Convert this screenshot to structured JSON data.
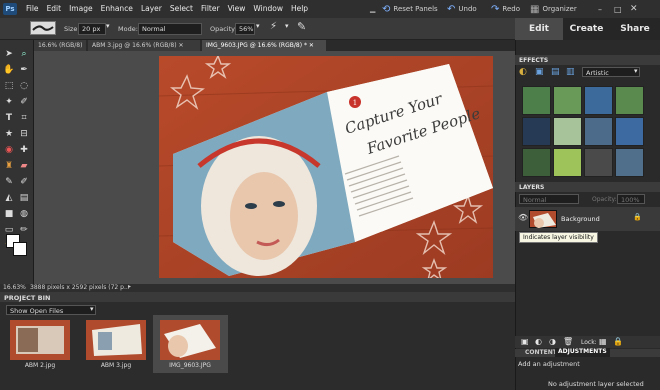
{
  "menubar": {
    "logo": "Ps",
    "menus": [
      "File",
      "Edit",
      "Image",
      "Enhance",
      "Layer",
      "Select",
      "Filter",
      "View",
      "Window",
      "Help"
    ],
    "reset_panels": "Reset Panels",
    "undo": "Undo",
    "redo": "Redo",
    "organizer": "Organizer"
  },
  "mode_tabs": {
    "edit": "Edit",
    "create": "Create",
    "share": "Share"
  },
  "options": {
    "size_label": "Size:",
    "size_value": "20 px",
    "mode_label": "Mode:",
    "mode_value": "Normal",
    "opacity_label": "Opacity:",
    "opacity_value": "56%"
  },
  "doc_tabs": [
    "16.6% (RGB/8)",
    "ABM 3.jpg @ 16.6% (RGB/8)",
    "IMG_9603.JPG @ 16.6% (RGB/8) *"
  ],
  "photo": {
    "headline_line1": "Capture Your",
    "headline_line2": "Favorite People"
  },
  "status": {
    "zoom": "16.63%",
    "info": "3888 pixels x 2592 pixels (72 p..."
  },
  "project_bin": {
    "title": "PROJECT BIN",
    "filter": "Show Open Files",
    "items": [
      "ABM 2.jpg",
      "ABM 3.jpg",
      "IMG_9603.JPG"
    ]
  },
  "effects": {
    "title": "EFFECTS",
    "filter": "Artistic"
  },
  "layers": {
    "title": "LAYERS",
    "blend": "Normal",
    "opacity_label": "Opacity:",
    "opacity_value": "100%",
    "layer_name": "Background",
    "tooltip": "Indicates layer visibility",
    "lock_label": "Lock:"
  },
  "adjustments": {
    "tab_content": "CONTENT",
    "tab_adjustments": "ADJUSTMENTS",
    "add": "Add an adjustment",
    "none": "No adjustment layer selected"
  }
}
